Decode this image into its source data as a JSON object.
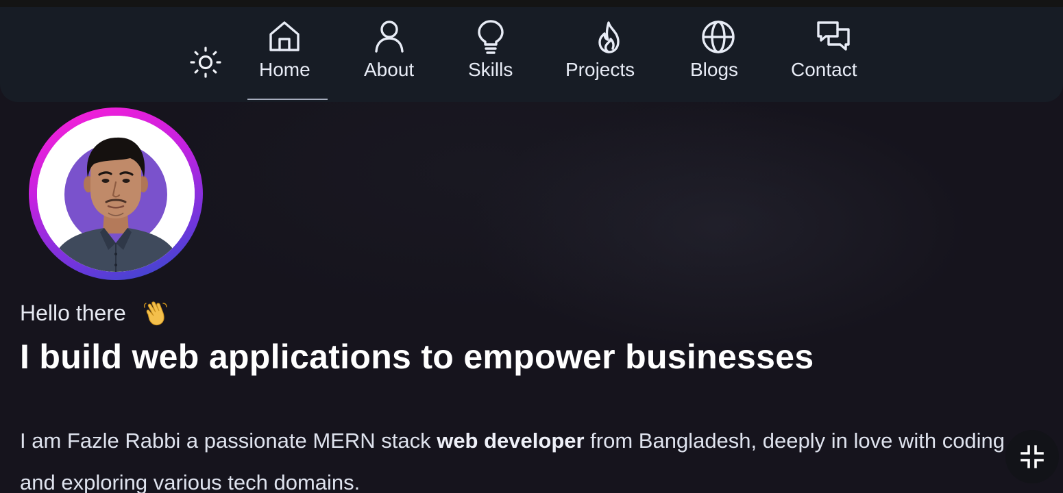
{
  "nav": {
    "theme_toggle_icon": "sun-icon",
    "items": [
      {
        "label": "Home",
        "icon": "home-icon",
        "active": true
      },
      {
        "label": "About",
        "icon": "user-icon"
      },
      {
        "label": "Skills",
        "icon": "lightbulb-icon"
      },
      {
        "label": "Projects",
        "icon": "flame-icon"
      },
      {
        "label": "Blogs",
        "icon": "globe-icon"
      },
      {
        "label": "Contact",
        "icon": "chat-icon"
      }
    ]
  },
  "hero": {
    "avatar_icon": "profile-photo",
    "greeting": "Hello there",
    "greeting_icon": "waving-hand-icon",
    "headline": "I build web applications to empower businesses",
    "bio": {
      "before": "I am Fazle Rabbi a passionate MERN stack ",
      "highlight": "web developer",
      "after": " from Bangladesh, deeply in love with coding and exploring various tech domains."
    }
  },
  "fab": {
    "icon": "exit-fullscreen-icon"
  },
  "colors": {
    "background": "#16141d",
    "navbar": "#171c25",
    "text": "#e8ecf6",
    "ring_start": "#ff1fd6",
    "ring_end": "#2a4ec8",
    "avatar_bg": "#7a52cc"
  }
}
